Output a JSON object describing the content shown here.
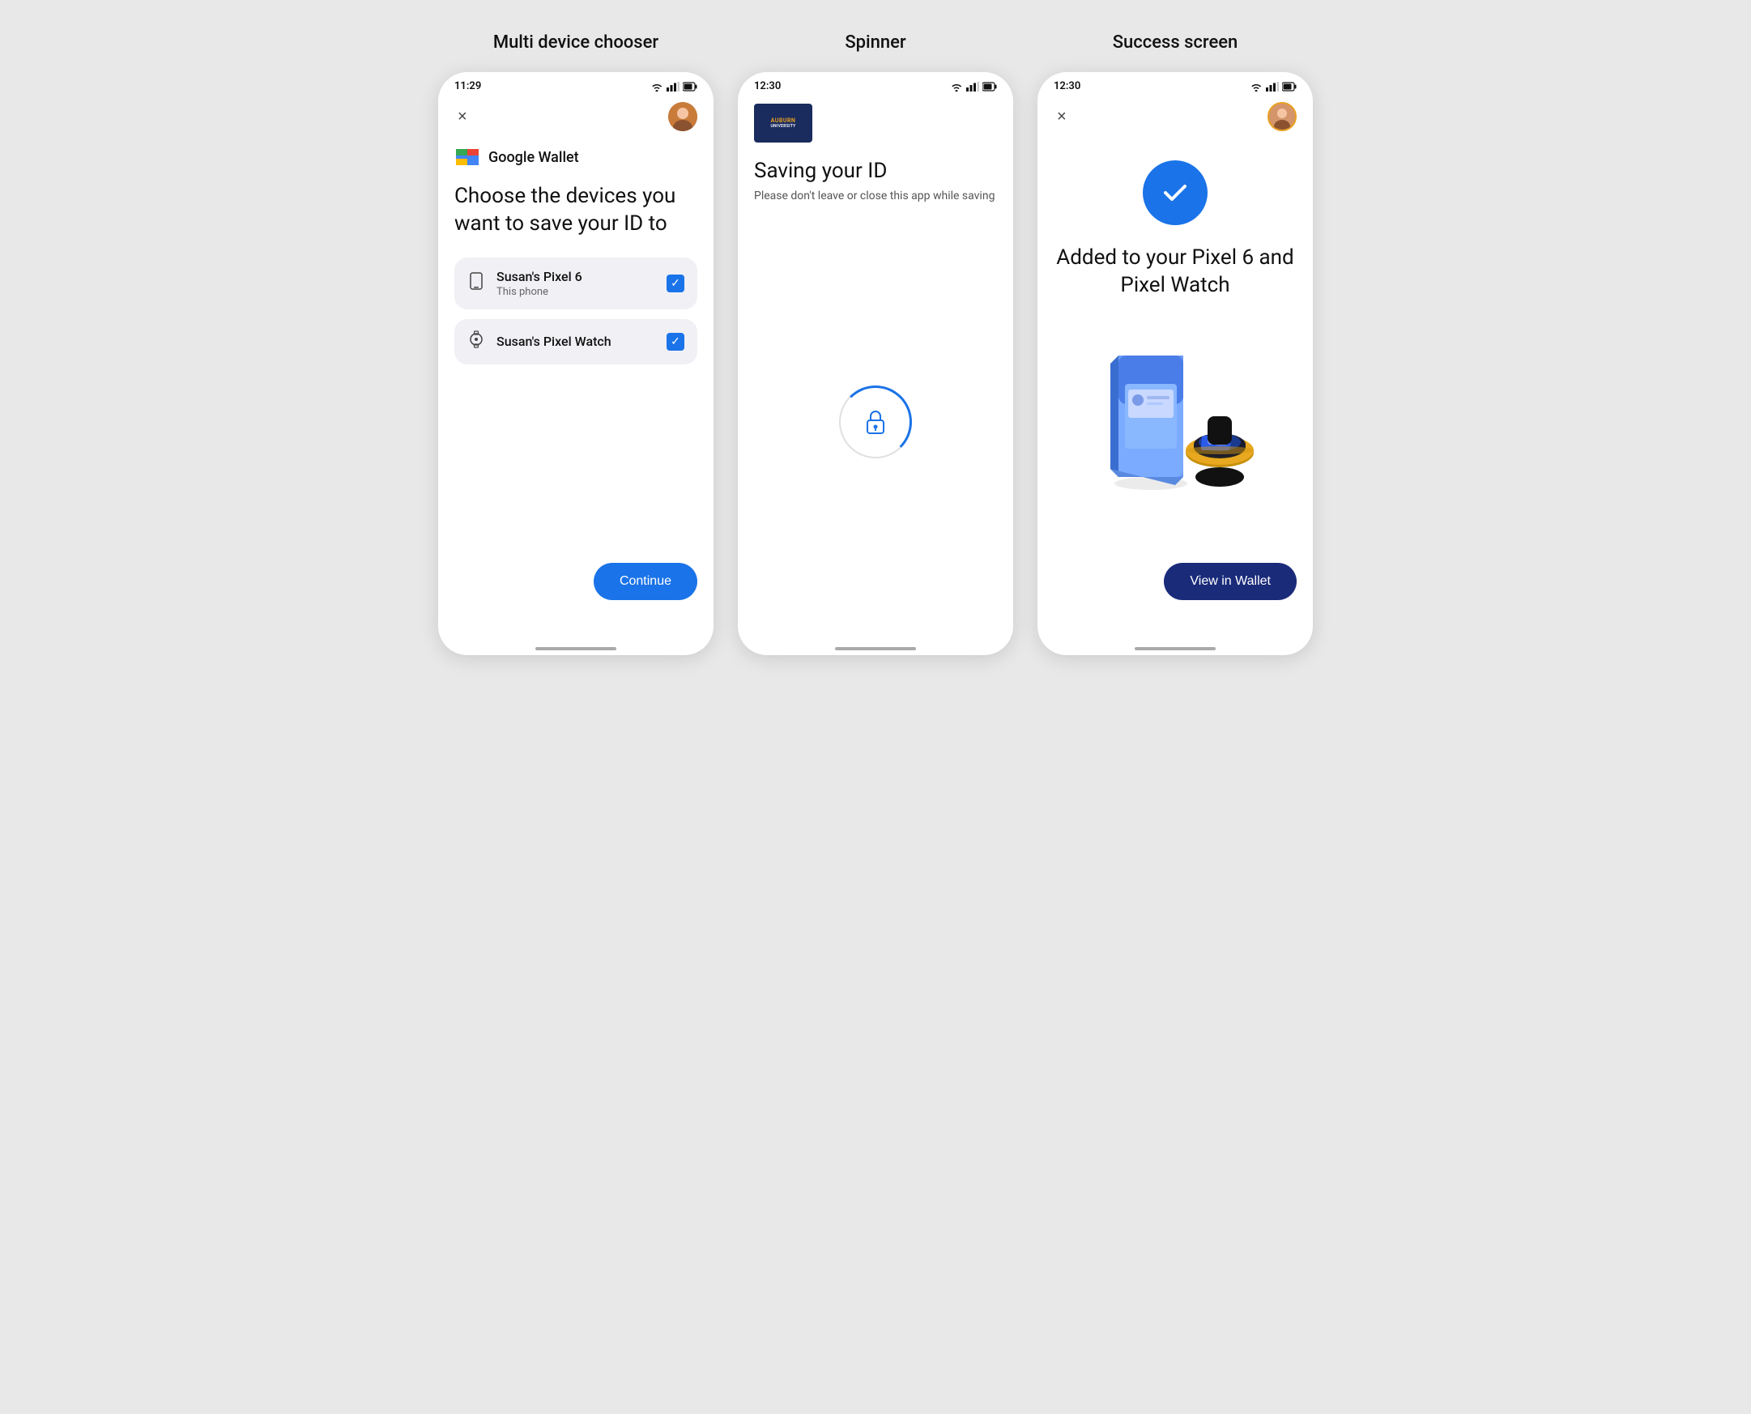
{
  "page": {
    "background": "#e8e8e8"
  },
  "screens": [
    {
      "id": "multi-device-chooser",
      "title": "Multi device chooser",
      "status_bar": {
        "time": "11:29"
      },
      "close_button": "×",
      "logo_text": "Google Wallet",
      "heading": "Choose the devices you want to save your ID to",
      "devices": [
        {
          "name": "Susan's Pixel 6",
          "sub": "This phone",
          "icon": "phone",
          "checked": true
        },
        {
          "name": "Susan's Pixel Watch",
          "sub": "",
          "icon": "watch",
          "checked": true
        }
      ],
      "continue_button": "Continue"
    },
    {
      "id": "spinner",
      "title": "Spinner",
      "status_bar": {
        "time": "12:30"
      },
      "logo": "Auburn University",
      "heading": "Saving your ID",
      "subtext": "Please don't leave or close this app while saving"
    },
    {
      "id": "success-screen",
      "title": "Success screen",
      "status_bar": {
        "time": "12:30"
      },
      "close_button": "×",
      "success_text": "Added to your Pixel 6 and Pixel Watch",
      "view_wallet_button": "View in Wallet"
    }
  ]
}
